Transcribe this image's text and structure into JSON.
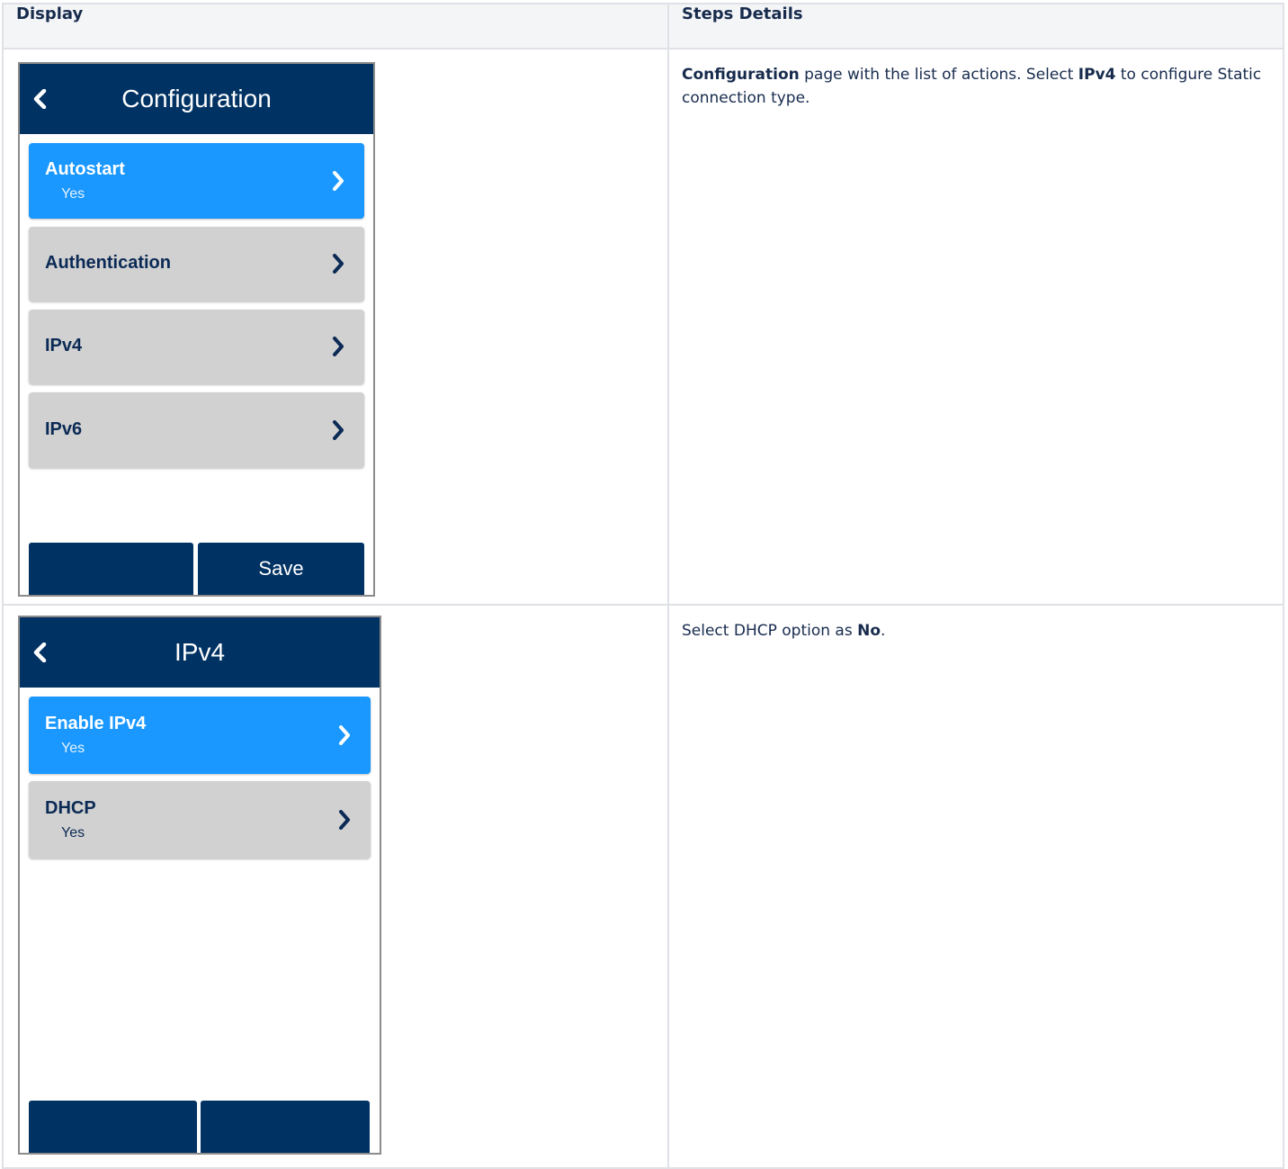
{
  "table": {
    "headers": [
      "Display",
      "Steps Details"
    ]
  },
  "rows": [
    {
      "screen": {
        "title": "Configuration",
        "items": [
          {
            "label": "Autostart",
            "value": "Yes",
            "active": true
          },
          {
            "label": "Authentication",
            "value": "",
            "active": false
          },
          {
            "label": "IPv4",
            "value": "",
            "active": false
          },
          {
            "label": "IPv6",
            "value": "",
            "active": false
          }
        ],
        "buttons": [
          "",
          "Save"
        ]
      },
      "desc": {
        "b1": "Configuration",
        "t1": " page with the list of actions. Select ",
        "b2": "IPv4",
        "t2": " to configure Static connection type."
      }
    },
    {
      "screen": {
        "title": "IPv4",
        "items": [
          {
            "label": "Enable IPv4",
            "value": "Yes",
            "active": true
          },
          {
            "label": "DHCP",
            "value": "Yes",
            "active": false
          }
        ],
        "buttons": [
          "",
          ""
        ]
      },
      "desc": {
        "t1": "Select DHCP option as ",
        "b1": "No",
        "t2": "."
      }
    }
  ],
  "colors": {
    "header_bg": "#003263",
    "active_item": "#1a98ff",
    "inactive_item": "#d1d1d1"
  },
  "icons": [
    "back-chevron-icon",
    "chevron-right-icon"
  ]
}
